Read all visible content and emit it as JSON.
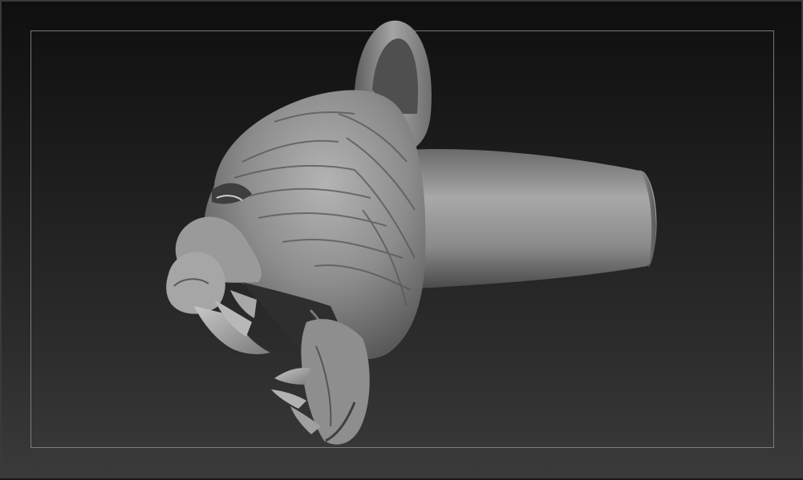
{
  "viewport": {
    "background_top": "#0f0f0f",
    "background_bottom": "#3a3a3a",
    "frame_color": "#8a8a8a",
    "material_color": "#9a9a9a"
  },
  "model": {
    "icon": "tiger-head-ring-icon"
  }
}
